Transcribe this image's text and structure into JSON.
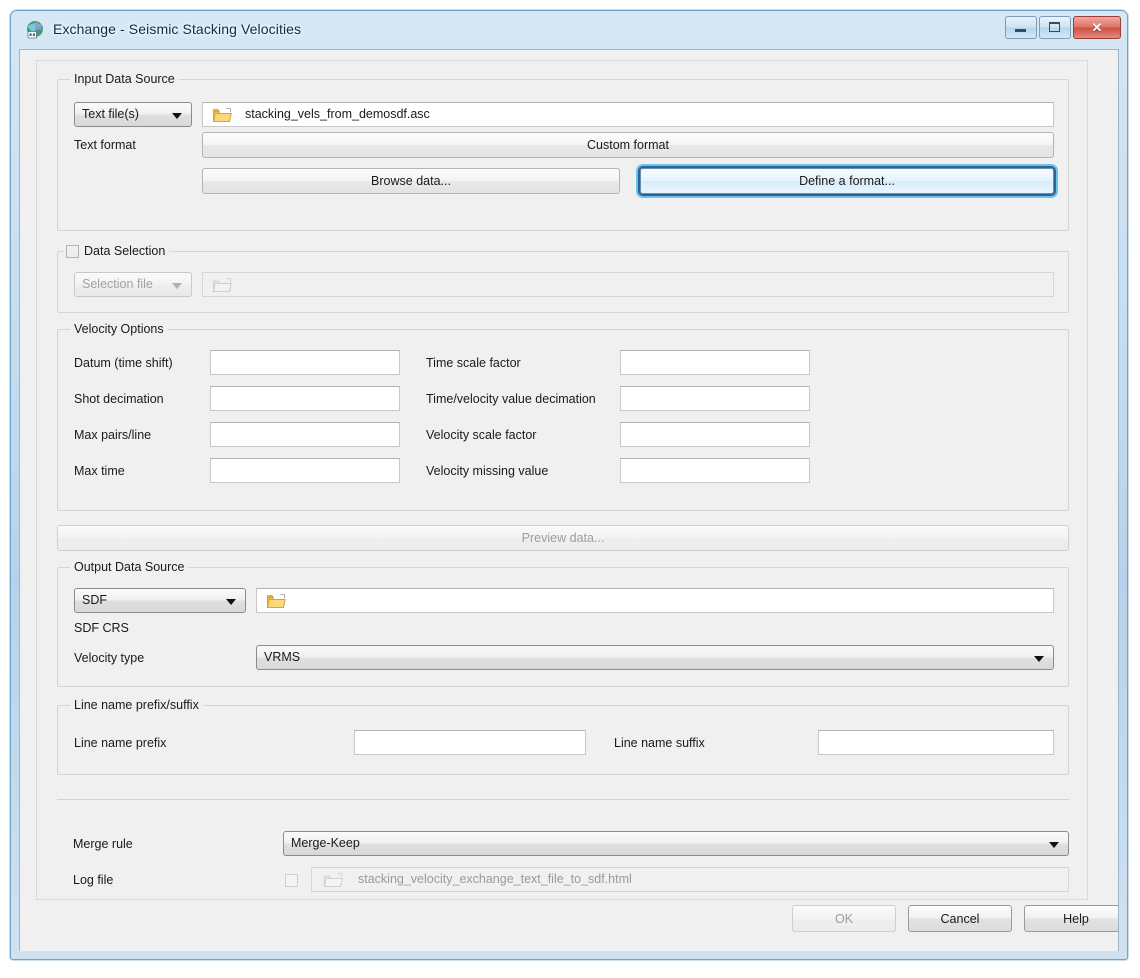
{
  "window": {
    "title": "Exchange - Seismic Stacking Velocities",
    "icon": "app-globe-icon",
    "buttons": {
      "minimize": "minimize-icon",
      "maximize": "maximize-icon",
      "close": "✕"
    }
  },
  "input_data_source": {
    "legend": "Input Data Source",
    "source_type": {
      "value": "Text file(s)",
      "options": [
        "Text file(s)"
      ]
    },
    "file_path": {
      "value": "stacking_vels_from_demosdf.asc",
      "placeholder": ""
    },
    "text_format_label": "Text format",
    "custom_format_button": "Custom format",
    "browse_data_button": "Browse data...",
    "define_format_button": "Define a format..."
  },
  "data_selection": {
    "legend": "Data Selection",
    "checked": false,
    "selection_type": {
      "value": "Selection file",
      "options": [
        "Selection file"
      ]
    },
    "selection_path": {
      "value": "",
      "placeholder": ""
    }
  },
  "velocity_options": {
    "legend": "Velocity Options",
    "left_fields": [
      {
        "label": "Datum (time shift)",
        "value": ""
      },
      {
        "label": "Shot decimation",
        "value": ""
      },
      {
        "label": "Max pairs/line",
        "value": ""
      },
      {
        "label": "Max time",
        "value": ""
      }
    ],
    "right_fields": [
      {
        "label": "Time scale factor",
        "value": ""
      },
      {
        "label": "Time/velocity value decimation",
        "value": ""
      },
      {
        "label": "Velocity scale factor",
        "value": ""
      },
      {
        "label": "Velocity missing value",
        "value": ""
      }
    ]
  },
  "preview_button": "Preview data...",
  "output_data_source": {
    "legend": "Output Data Source",
    "target_type": {
      "value": "SDF",
      "options": [
        "SDF"
      ]
    },
    "output_path": {
      "value": "",
      "placeholder": ""
    },
    "crs_label": "SDF CRS",
    "crs_value": "",
    "velocity_type_label": "Velocity type",
    "velocity_type": {
      "value": "VRMS",
      "options": [
        "VRMS"
      ]
    }
  },
  "line_name": {
    "legend": "Line name prefix/suffix",
    "prefix_label": "Line name prefix",
    "prefix_value": "",
    "suffix_label": "Line name suffix",
    "suffix_value": ""
  },
  "footer": {
    "merge_rule_label": "Merge rule",
    "merge_rule": {
      "value": "Merge-Keep",
      "options": [
        "Merge-Keep"
      ]
    },
    "log_file_label": "Log file",
    "log_file_checked": false,
    "log_file_value": "stacking_velocity_exchange_text_file_to_sdf.html"
  },
  "dialog_buttons": {
    "ok": "OK",
    "ok_enabled": false,
    "cancel": "Cancel",
    "help": "Help"
  },
  "colors": {
    "focus_ring": "#2f6291",
    "focus_glow": "#68c3ef",
    "window_chrome": "#b9d4ea",
    "panel_bg": "#f0f0f0",
    "close_button": "#cd4f40"
  }
}
